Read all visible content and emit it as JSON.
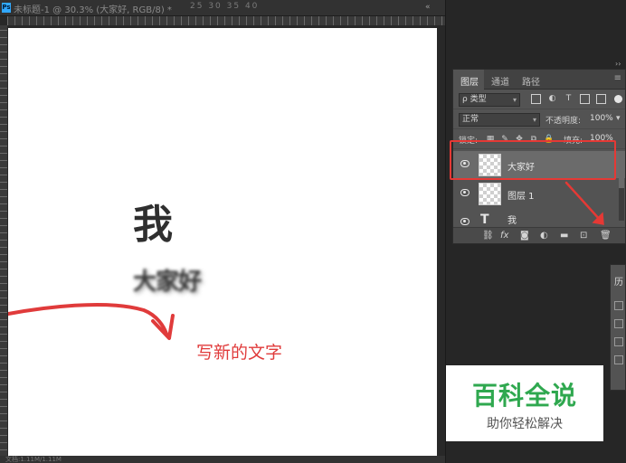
{
  "document": {
    "app_badge": "Ps",
    "title": "未标题-1 @ 30.3% (大家好, RGB/8) *",
    "ruler_numbers": "25 30 35 40",
    "collapse_glyph": "«"
  },
  "canvas": {
    "big_char": "我",
    "blurred_text": "大家好",
    "annotation": "写新的文字",
    "annotation_color": "#e03b3b"
  },
  "layers_panel": {
    "tabs": [
      {
        "label": "图层",
        "active": true
      },
      {
        "label": "通道",
        "active": false
      },
      {
        "label": "路径",
        "active": false
      }
    ],
    "menu_glyph": "≡",
    "filter": {
      "label": "ρ 类型",
      "icons": [
        "image-filter-icon",
        "adjustment-filter-icon",
        "type-filter-icon",
        "shape-filter-icon",
        "smart-object-filter-icon"
      ]
    },
    "blend_mode": "正常",
    "opacity_label": "不透明度:",
    "opacity_value": "100%",
    "lock_label": "锁定:",
    "fill_label": "填充:",
    "fill_value": "100%",
    "layers": [
      {
        "name": "大家好",
        "selected": true,
        "kind": "raster"
      },
      {
        "name": "图层 1",
        "selected": false,
        "kind": "raster"
      },
      {
        "name": "我",
        "selected": false,
        "kind": "type"
      }
    ],
    "bottom_icons": [
      "link-icon",
      "fx-icon",
      "mask-icon",
      "adjustment-icon",
      "folder-icon",
      "new-layer-icon",
      "trash-icon"
    ],
    "highlight_color": "#e53935"
  },
  "history_panel": {
    "tab_label": "历"
  },
  "watermark": {
    "title": "百科全说",
    "subtitle": "助你轻松解决",
    "title_color": "#2fa84f"
  },
  "status": {
    "text": "文档:1.11M/1.11M"
  }
}
